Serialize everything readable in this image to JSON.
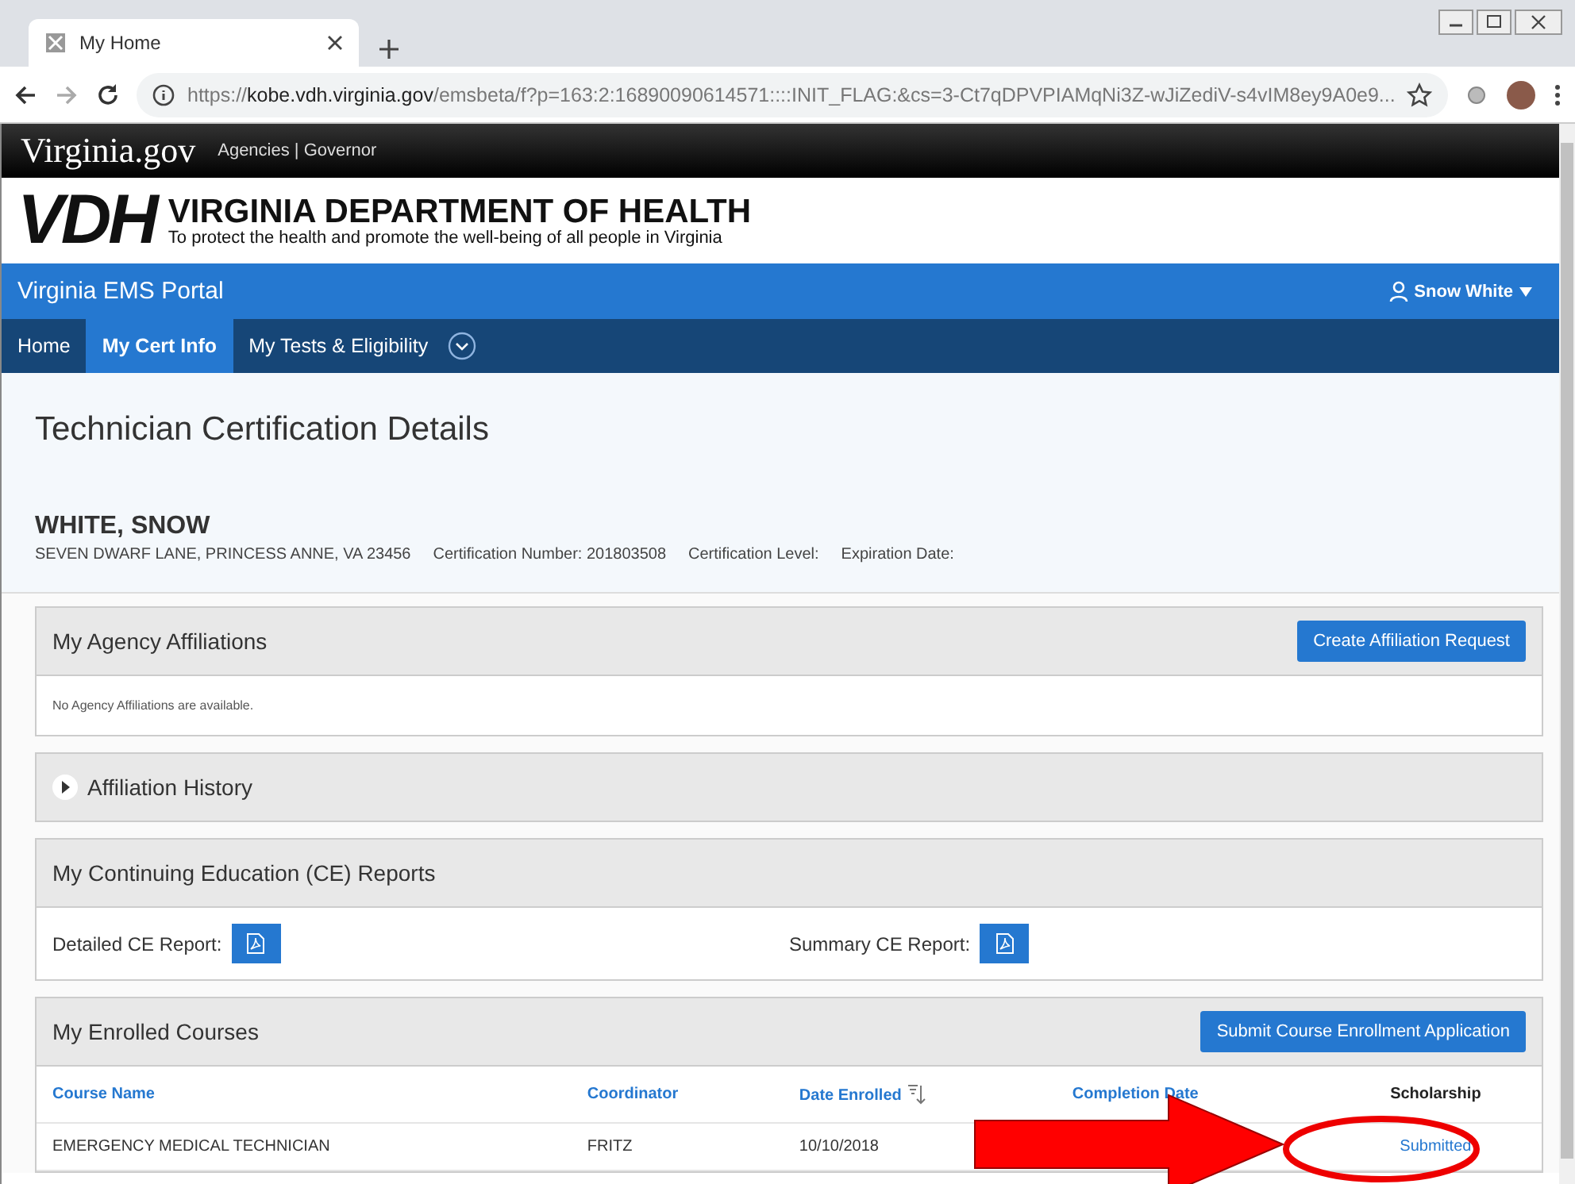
{
  "browser": {
    "tab": {
      "title": "My Home",
      "selected": true
    },
    "url": {
      "scheme": "https://",
      "host": "kobe.vdh.virginia.gov",
      "path": "/emsbeta/f?p=163:2:16890090614571::::INIT_FLAG:&cs=3-Ct7qDPVPIAMqNi3Z-wJiZediV-s4vIM8ey9A0e9..."
    }
  },
  "gov_bar": {
    "logo": "Virginia.gov",
    "links": "Agencies | Governor"
  },
  "agency_header": {
    "logo": "VDH",
    "name": "VIRGINIA DEPARTMENT OF HEALTH",
    "tagline": "To protect the health and promote the well-being of all people in Virginia"
  },
  "portal_bar": {
    "title": "Virginia EMS Portal",
    "user": "Snow White"
  },
  "nav": [
    {
      "label": "Home",
      "selected": false
    },
    {
      "label": "My Cert Info",
      "selected": true
    },
    {
      "label": "My Tests & Eligibility",
      "selected": false
    }
  ],
  "page_title": "Technician Certification Details",
  "person": {
    "name": "WHITE, SNOW",
    "address": "SEVEN DWARF LANE, PRINCESS ANNE, VA 23456",
    "fields": [
      {
        "label": "Certification Number:",
        "value": "201803508"
      },
      {
        "label": "Certification Level:"
      },
      {
        "label": "Expiration Date:"
      }
    ]
  },
  "sections": [
    {
      "kind": "list",
      "title": "My Agency Affiliations",
      "button": "Create Affiliation Request",
      "message": "No Agency Affiliations are available."
    },
    {
      "kind": "collapsible",
      "title": "Affiliation History",
      "expanded": false
    },
    {
      "kind": "reports",
      "title": "My Continuing Education (CE) Reports",
      "reports": [
        "Detailed CE Report:",
        "Summary CE Report:"
      ]
    },
    {
      "kind": "table",
      "title": "My Enrolled Courses",
      "button": "Submit Course Enrollment Application",
      "columns": [
        {
          "label": "Course Name",
          "kind": "link",
          "sorted": false
        },
        {
          "label": "Coordinator",
          "kind": "link",
          "sorted": false
        },
        {
          "label": "Date Enrolled",
          "kind": "link",
          "sorted": true
        },
        {
          "label": "Completion Date",
          "kind": "link",
          "sorted": false
        },
        {
          "label": "Scholarship",
          "kind": "plain",
          "sorted": false
        }
      ],
      "rows": [
        [
          {
            "text": "EMERGENCY MEDICAL TECHNICIAN",
            "kind": "plain"
          },
          {
            "text": "FRITZ",
            "kind": "plain"
          },
          {
            "text": "10/10/2018",
            "kind": "plain"
          },
          {
            "text": "",
            "kind": "plain"
          },
          {
            "text": "Submitted",
            "kind": "link"
          }
        ]
      ]
    }
  ],
  "annotations": [
    {
      "kind": "arrow"
    },
    {
      "kind": "ellipse"
    }
  ]
}
